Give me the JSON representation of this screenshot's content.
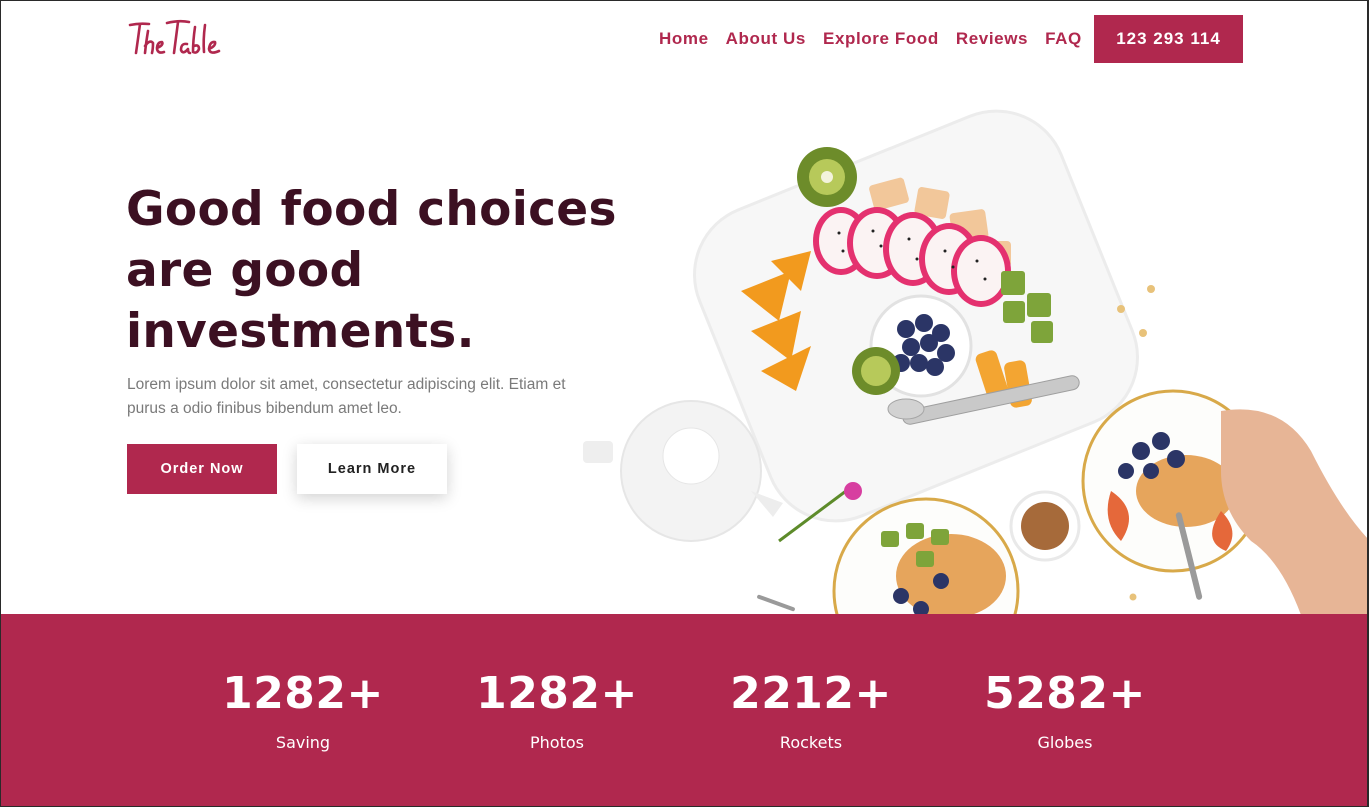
{
  "brand": {
    "logo_text": "The Table",
    "accent_color": "#b0284e",
    "title_color": "#3c1022"
  },
  "nav": {
    "items": [
      {
        "label": "Home"
      },
      {
        "label": "About Us"
      },
      {
        "label": "Explore Food"
      },
      {
        "label": "Reviews"
      },
      {
        "label": "FAQ"
      }
    ],
    "phone": "123 293 114"
  },
  "hero": {
    "title_line1": "Good food choices",
    "title_line2": "are good",
    "title_line3": "investments.",
    "text": "Lorem ipsum dolor sit amet, consectetur adipiscing elit. Etiam et purus a odio finibus bibendum amet leo.",
    "primary_button": "Order Now",
    "secondary_button": "Learn More",
    "image_icon": "food-platter-photo"
  },
  "stats": [
    {
      "number": "1282+",
      "label": "Saving"
    },
    {
      "number": "1282+",
      "label": "Photos"
    },
    {
      "number": "2212+",
      "label": "Rockets"
    },
    {
      "number": "5282+",
      "label": "Globes"
    }
  ]
}
